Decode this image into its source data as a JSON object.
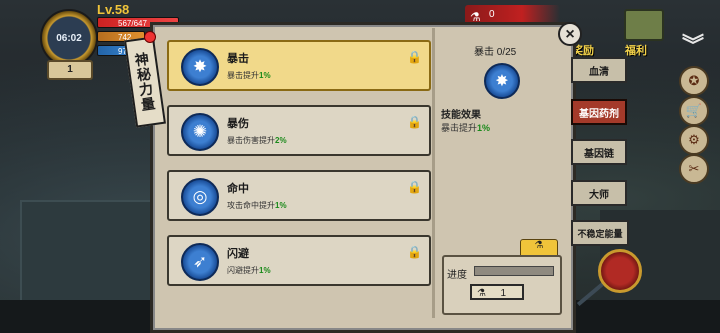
{
  "hud": {
    "clock": "06:02",
    "level": "Lv.58",
    "hp": "567/647",
    "sp": "742",
    "mp": "97",
    "counter": "1"
  },
  "currency": {
    "amount": "0",
    "icon": "flask-icon"
  },
  "top_right": {
    "event_label": "奖励",
    "reward_label": "福利"
  },
  "vertical_tab": {
    "label": "神秘力量"
  },
  "skills": [
    {
      "name": "暴击",
      "desc_prefix": "暴击提升",
      "desc_value": "1%",
      "icon": "star-burst-icon",
      "selected": true
    },
    {
      "name": "暴伤",
      "desc_prefix": "暴击伤害提升",
      "desc_value": "2%",
      "icon": "explosion-icon"
    },
    {
      "name": "命中",
      "desc_prefix": "攻击命中提升",
      "desc_value": "1%",
      "icon": "target-icon"
    },
    {
      "name": "闪避",
      "desc_prefix": "闪避提升",
      "desc_value": "1%",
      "icon": "wing-icon"
    }
  ],
  "detail": {
    "title": "暴击  0/25",
    "effect_header": "技能效果",
    "effect_prefix": "暴击提升",
    "effect_value": "1%"
  },
  "progress": {
    "label": "进度",
    "cost": "1"
  },
  "right_tabs": [
    {
      "label": "血清"
    },
    {
      "label": "基因药剂"
    },
    {
      "label": "基因链"
    },
    {
      "label": "大师"
    },
    {
      "label": "不稳定能量"
    }
  ]
}
